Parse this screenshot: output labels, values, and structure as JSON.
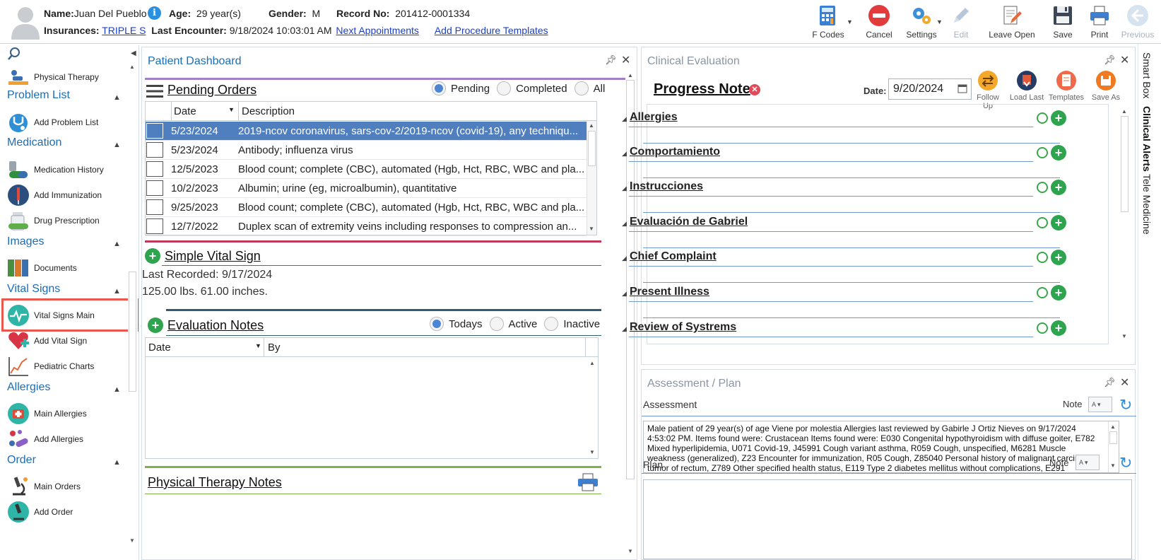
{
  "patient": {
    "name_label": "Name:",
    "name": "Juan Del Pueblo",
    "age_label": "Age:",
    "age": "29 year(s)",
    "gender_label": "Gender:",
    "gender": "M",
    "record_label": "Record No:",
    "record": "201412-0001334",
    "insurances_label": "Insurances:",
    "insurance": "TRIPLE S",
    "last_encounter_label": "Last Encounter:",
    "last_encounter": "9/18/2024 10:03:01 AM",
    "next_appointments": "Next Appointments",
    "add_procedure_templates": "Add Procedure Templates"
  },
  "toolbar": {
    "fcodes": "F Codes",
    "cancel": "Cancel",
    "settings": "Settings",
    "edit": "Edit",
    "leave_open": "Leave Open",
    "save": "Save",
    "print": "Print",
    "previous": "Previous"
  },
  "sidebar": {
    "physical_therapy": "Physical Therapy",
    "problem_list": "Problem List",
    "add_problem_list": "Add Problem List",
    "medication": "Medication",
    "medication_history": "Medication History",
    "add_immunization": "Add Immunization",
    "drug_prescription": "Drug Prescription",
    "images": "Images",
    "documents": "Documents",
    "vital_signs": "Vital Signs",
    "vital_signs_main": "Vital Signs Main",
    "add_vital_sign": "Add Vital Sign",
    "pediatric_charts": "Pediatric Charts",
    "allergies": "Allergies",
    "main_allergies": "Main Allergies",
    "add_allergies": "Add Allergies",
    "order": "Order",
    "main_orders": "Main Orders",
    "add_order": "Add Order"
  },
  "dashboard": {
    "title": "Patient Dashboard",
    "pending_orders": {
      "title": "Pending Orders",
      "filters": [
        "Pending",
        "Completed",
        "All"
      ],
      "selected_filter": "Pending",
      "columns": [
        "Date",
        "Description"
      ],
      "rows": [
        {
          "date": "5/23/2024",
          "description": "2019-ncov coronavirus, sars-cov-2/2019-ncov (covid-19), any techniqu..."
        },
        {
          "date": "5/23/2024",
          "description": "Antibody; influenza virus"
        },
        {
          "date": "12/5/2023",
          "description": "Blood count; complete (CBC), automated (Hgb, Hct, RBC, WBC and pla..."
        },
        {
          "date": "10/2/2023",
          "description": "Albumin; urine (eg, microalbumin), quantitative"
        },
        {
          "date": "9/25/2023",
          "description": "Blood count; complete (CBC), automated (Hgb, Hct, RBC, WBC and pla..."
        },
        {
          "date": "12/7/2022",
          "description": "Duplex scan of extremity veins including responses to compression an..."
        }
      ]
    },
    "simple_vital_sign": {
      "title": "Simple Vital Sign",
      "last_recorded": "Last Recorded: 9/17/2024",
      "values": "125.00 lbs. 61.00 inches."
    },
    "evaluation_notes": {
      "title": "Evaluation Notes",
      "filters": [
        "Todays",
        "Active",
        "Inactive"
      ],
      "selected_filter": "Todays",
      "columns": [
        "Date",
        "By"
      ]
    },
    "physical_therapy_notes": {
      "title": "Physical Therapy Notes"
    }
  },
  "clinical_evaluation": {
    "title": "Clinical Evaluation",
    "note_title": "Progress Note",
    "date_label": "Date:",
    "date_value": "9/20/2024",
    "actions": [
      "Follow Up",
      "Load Last",
      "Templates",
      "Save As"
    ],
    "sections": [
      "Allergies",
      "Comportamiento",
      "Instrucciones",
      "Evaluación de Gabriel",
      "Chief Complaint",
      "Present Illness",
      "Review of Systrems"
    ]
  },
  "assessment_plan": {
    "title": "Assessment / Plan",
    "assessment_label": "Assessment",
    "note_label": "Note",
    "assessment_text": "Male patient of 29 year(s) of age Viene por molestia     Allergies last reviewed by Gabirle J Ortiz Nieves on 9/17/2024 4:53:02 PM.    Items found were:  Crustacean  Items found were:  E030 Congenital hypothyroidism with diffuse goiter, E782 Mixed hyperlipidemia, U071 Covid-19, J45991 Cough variant asthma, R059 Cough, unspecified, M6281 Muscle weakness (generalized), Z23 Encounter for immunization, R05 Cough, Z85040 Personal history of malignant carcinoid tumor of rectum, Z789 Other specified health status, E119 Type 2 diabetes mellitus without complications, E291",
    "plan_label": "Plan"
  },
  "right_rail": [
    "Smart Box",
    "Clinical Alerts",
    "Tele Medicine"
  ],
  "colors": {
    "accent_blue": "#1b6db8",
    "selected_row": "#4f7fbf",
    "highlight_red": "#e8584f",
    "add_green": "#2ea44f"
  }
}
